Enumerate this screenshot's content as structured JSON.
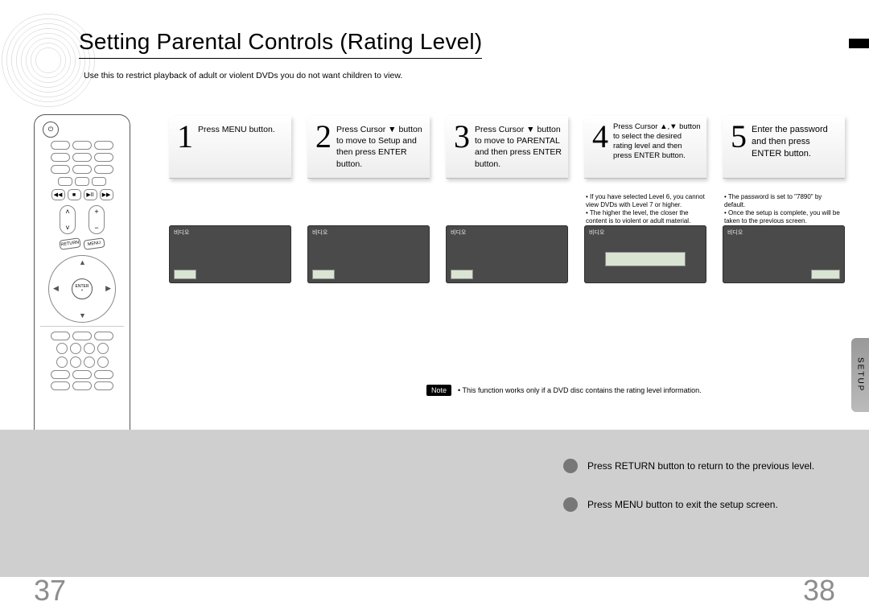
{
  "title": "Setting Parental Controls (Rating Level)",
  "subtitle": "Use this to restrict playback of adult or violent DVDs you do not want children to view.",
  "side_tab": "SETUP",
  "screen_label": "비디오",
  "remote": {
    "enter": "ENTER",
    "menu": "MENU"
  },
  "steps": [
    {
      "num": "1",
      "text": "Press MENU button."
    },
    {
      "num": "2",
      "text": "Press Cursor ▼ button to move to  Setup  and then press ENTER button."
    },
    {
      "num": "3",
      "text": "Press Cursor ▼ button to move to  PARENTAL  and then press ENTER button."
    },
    {
      "num": "4",
      "text": "Press Cursor ▲,▼ button to select the desired rating level and then press ENTER button.",
      "notes": [
        "If you have selected Level 6, you cannot view DVDs with Level 7 or higher.",
        "The higher the level, the closer the content is to violent or adult material."
      ]
    },
    {
      "num": "5",
      "text": "Enter the password and then press ENTER button.",
      "notes": [
        "The password is set to \"7890\" by default.",
        "Once the setup is complete, you will be taken to the previous screen."
      ]
    }
  ],
  "note": {
    "label": "Note",
    "text": "• This function works only if a DVD disc contains the rating level information."
  },
  "footer": {
    "line1": "Press RETURN button to return to the previous level.",
    "line2": "Press MENU button to exit the setup screen."
  },
  "pages": {
    "left": "37",
    "right": "38"
  }
}
